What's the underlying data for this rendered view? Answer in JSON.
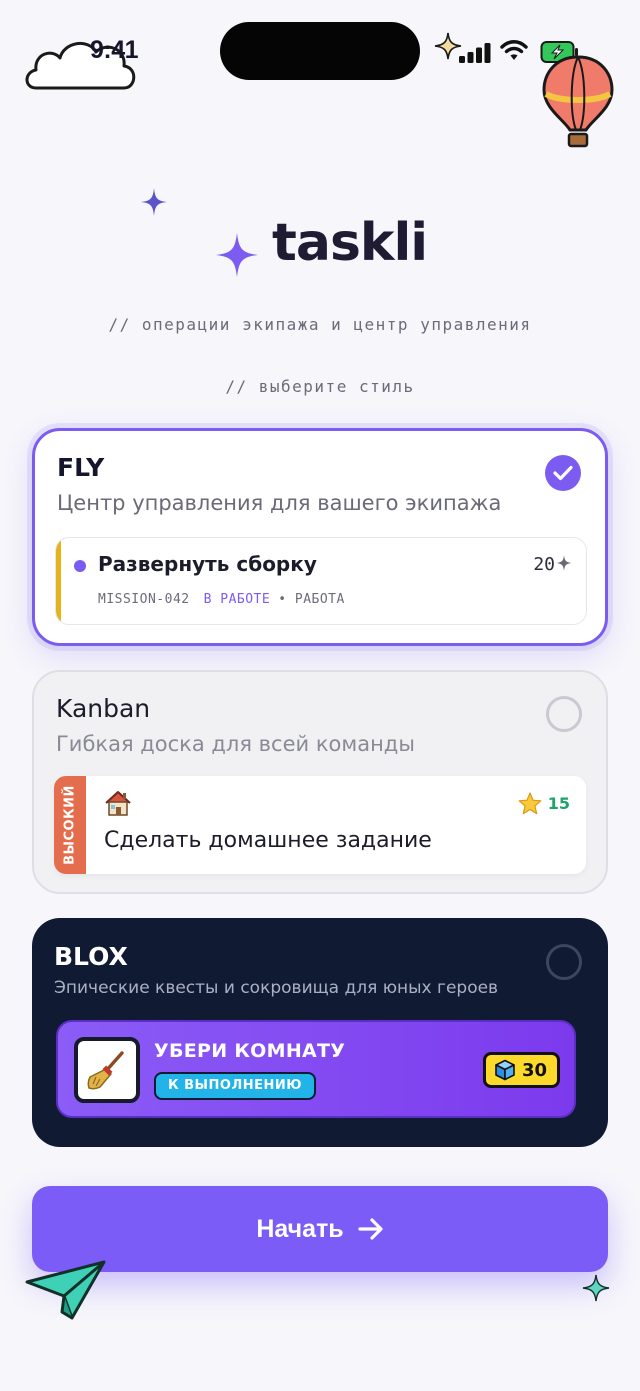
{
  "status_bar": {
    "time": "9:41"
  },
  "app": {
    "name": "taskli",
    "tagline": "// операции экипажа и центр управления",
    "choose_style": "// выберите стиль"
  },
  "styles": [
    {
      "title": "FLY",
      "subtitle": "Центр управления для вашего экипажа",
      "selected": true,
      "task": {
        "name": "Развернуть сборку",
        "points": "20",
        "id": "MISSION-042",
        "status": "В РАБОТЕ",
        "tag": "• РАБОТА"
      }
    },
    {
      "title": "Kanban",
      "subtitle": "Гибкая доска для всей команды",
      "selected": false,
      "task": {
        "priority": "ВЫСОКИЙ",
        "emoji": "house-icon",
        "name": "Сделать домашнее задание",
        "points": "15"
      }
    },
    {
      "title": "BLOX",
      "subtitle": "Эпические квесты и сокровища для юных героев",
      "selected": false,
      "task": {
        "icon": "broom-icon",
        "name": "УБЕРИ КОМНАТУ",
        "status": "К ВЫПОЛНЕНИЮ",
        "points": "30"
      }
    }
  ],
  "start_button": {
    "label": "Начать"
  },
  "colors": {
    "accent": "#7c5cf6",
    "dark_card": "#111a33",
    "priority_high": "#e46d4d",
    "points_green": "#1ea36b",
    "coin_yellow": "#fcd92a"
  }
}
